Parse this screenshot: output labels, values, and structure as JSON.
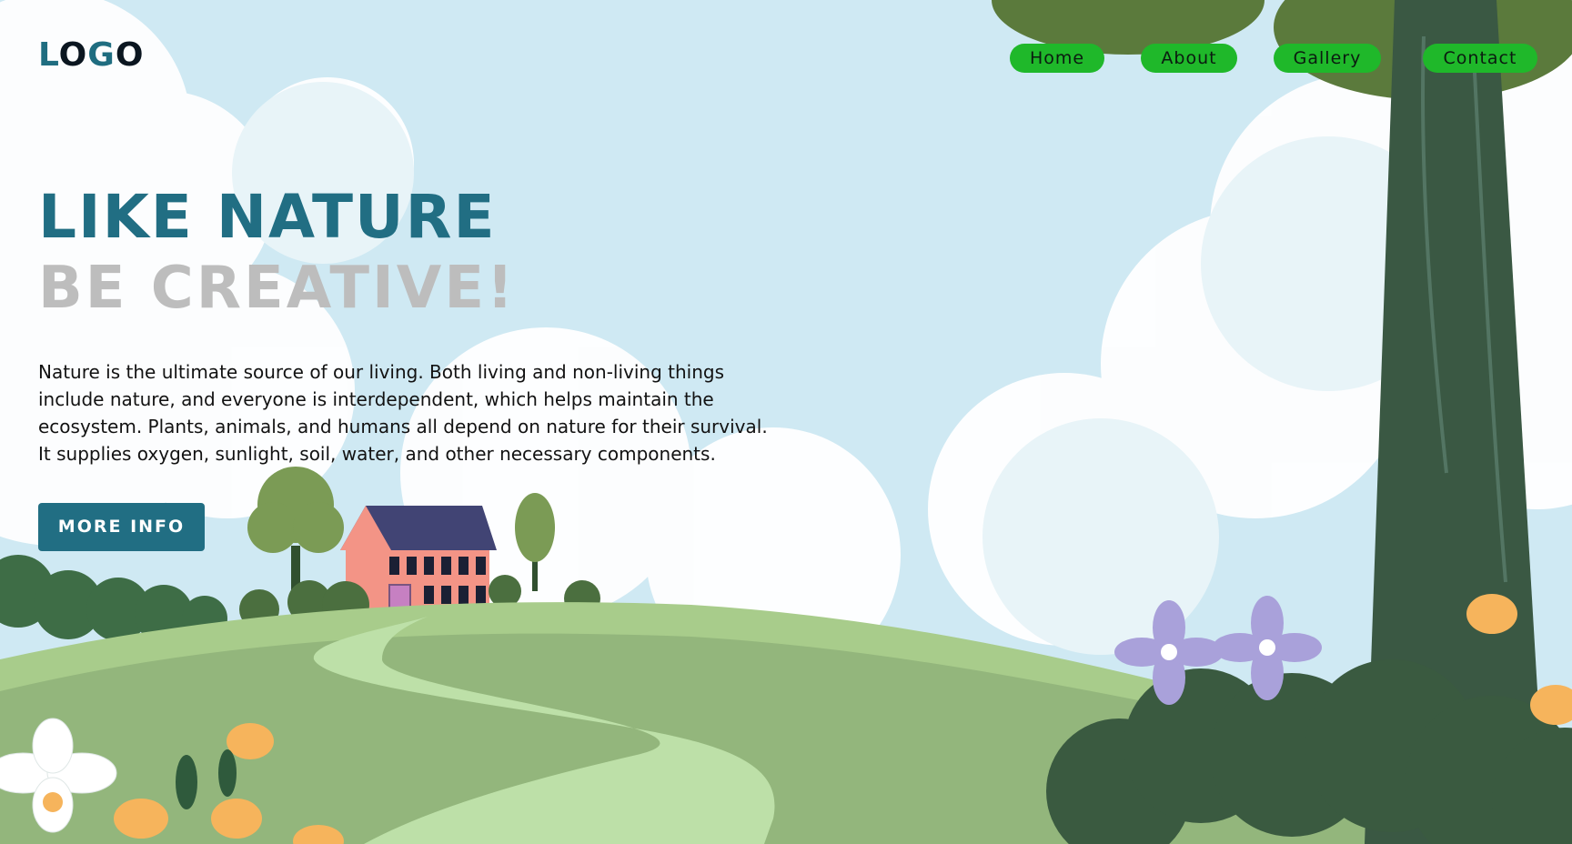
{
  "brand": {
    "logo": "LOGO"
  },
  "nav": {
    "items": [
      {
        "label": "Home"
      },
      {
        "label": "About"
      },
      {
        "label": "Gallery"
      },
      {
        "label": "Contact"
      }
    ]
  },
  "hero": {
    "headline": "LIKE NATURE",
    "subheadline": "BE CREATIVE!",
    "description_lines": [
      "Nature is the ultimate source of our living. Both living and non-living things",
      "include nature, and everyone is interdependent, which helps maintain the",
      "ecosystem. Plants, animals, and humans all depend on nature for their survival.",
      "It supplies oxygen, sunlight, soil, water, and other necessary components."
    ],
    "cta_label": "MORE INFO"
  },
  "colors": {
    "sky": "#cfe9f3",
    "brand": "#216e83",
    "nav_button": "#1fb82a",
    "subheadline": "#bdbdbd",
    "hill": "#93b67c",
    "path": "#bde0a8",
    "tree_trunk": "#3a5843",
    "foliage_dark": "#3a5a40"
  },
  "icons": {
    "house": "house-illustration",
    "tree": "tree-illustration",
    "flower": "flower-illustration"
  }
}
